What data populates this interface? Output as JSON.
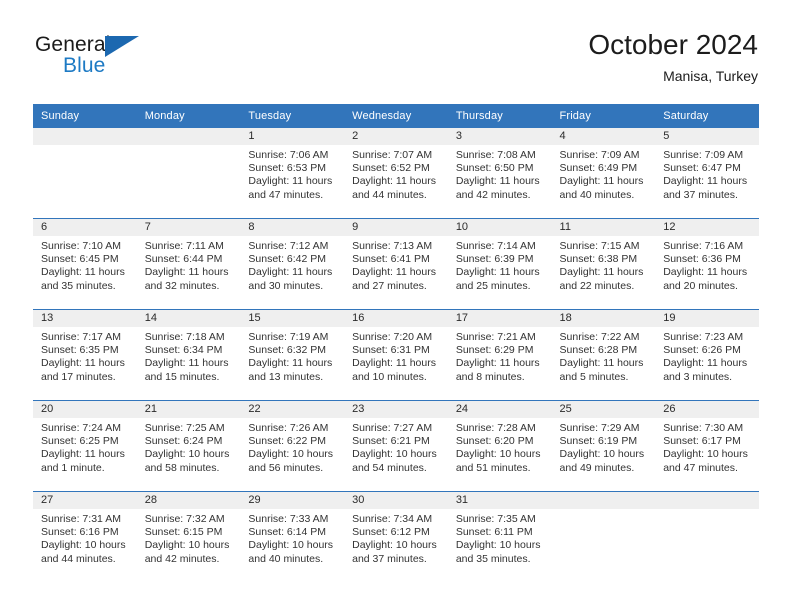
{
  "brand": {
    "name_top": "General",
    "name_bottom": "Blue",
    "accent_color": "#1c68b0",
    "blue_text_color": "#1d7ac4"
  },
  "header": {
    "title": "October 2024",
    "subtitle": "Manisa, Turkey"
  },
  "theme": {
    "header_blue": "#3275bb",
    "daynum_band": "#efefef",
    "text": "#333333"
  },
  "calendar": {
    "weekday_headers": [
      "Sunday",
      "Monday",
      "Tuesday",
      "Wednesday",
      "Thursday",
      "Friday",
      "Saturday"
    ],
    "weeks": [
      [
        {
          "day": "",
          "sunrise": "",
          "sunset": "",
          "daylight": ""
        },
        {
          "day": "",
          "sunrise": "",
          "sunset": "",
          "daylight": ""
        },
        {
          "day": "1",
          "sunrise": "Sunrise: 7:06 AM",
          "sunset": "Sunset: 6:53 PM",
          "daylight": "Daylight: 11 hours and 47 minutes."
        },
        {
          "day": "2",
          "sunrise": "Sunrise: 7:07 AM",
          "sunset": "Sunset: 6:52 PM",
          "daylight": "Daylight: 11 hours and 44 minutes."
        },
        {
          "day": "3",
          "sunrise": "Sunrise: 7:08 AM",
          "sunset": "Sunset: 6:50 PM",
          "daylight": "Daylight: 11 hours and 42 minutes."
        },
        {
          "day": "4",
          "sunrise": "Sunrise: 7:09 AM",
          "sunset": "Sunset: 6:49 PM",
          "daylight": "Daylight: 11 hours and 40 minutes."
        },
        {
          "day": "5",
          "sunrise": "Sunrise: 7:09 AM",
          "sunset": "Sunset: 6:47 PM",
          "daylight": "Daylight: 11 hours and 37 minutes."
        }
      ],
      [
        {
          "day": "6",
          "sunrise": "Sunrise: 7:10 AM",
          "sunset": "Sunset: 6:45 PM",
          "daylight": "Daylight: 11 hours and 35 minutes."
        },
        {
          "day": "7",
          "sunrise": "Sunrise: 7:11 AM",
          "sunset": "Sunset: 6:44 PM",
          "daylight": "Daylight: 11 hours and 32 minutes."
        },
        {
          "day": "8",
          "sunrise": "Sunrise: 7:12 AM",
          "sunset": "Sunset: 6:42 PM",
          "daylight": "Daylight: 11 hours and 30 minutes."
        },
        {
          "day": "9",
          "sunrise": "Sunrise: 7:13 AM",
          "sunset": "Sunset: 6:41 PM",
          "daylight": "Daylight: 11 hours and 27 minutes."
        },
        {
          "day": "10",
          "sunrise": "Sunrise: 7:14 AM",
          "sunset": "Sunset: 6:39 PM",
          "daylight": "Daylight: 11 hours and 25 minutes."
        },
        {
          "day": "11",
          "sunrise": "Sunrise: 7:15 AM",
          "sunset": "Sunset: 6:38 PM",
          "daylight": "Daylight: 11 hours and 22 minutes."
        },
        {
          "day": "12",
          "sunrise": "Sunrise: 7:16 AM",
          "sunset": "Sunset: 6:36 PM",
          "daylight": "Daylight: 11 hours and 20 minutes."
        }
      ],
      [
        {
          "day": "13",
          "sunrise": "Sunrise: 7:17 AM",
          "sunset": "Sunset: 6:35 PM",
          "daylight": "Daylight: 11 hours and 17 minutes."
        },
        {
          "day": "14",
          "sunrise": "Sunrise: 7:18 AM",
          "sunset": "Sunset: 6:34 PM",
          "daylight": "Daylight: 11 hours and 15 minutes."
        },
        {
          "day": "15",
          "sunrise": "Sunrise: 7:19 AM",
          "sunset": "Sunset: 6:32 PM",
          "daylight": "Daylight: 11 hours and 13 minutes."
        },
        {
          "day": "16",
          "sunrise": "Sunrise: 7:20 AM",
          "sunset": "Sunset: 6:31 PM",
          "daylight": "Daylight: 11 hours and 10 minutes."
        },
        {
          "day": "17",
          "sunrise": "Sunrise: 7:21 AM",
          "sunset": "Sunset: 6:29 PM",
          "daylight": "Daylight: 11 hours and 8 minutes."
        },
        {
          "day": "18",
          "sunrise": "Sunrise: 7:22 AM",
          "sunset": "Sunset: 6:28 PM",
          "daylight": "Daylight: 11 hours and 5 minutes."
        },
        {
          "day": "19",
          "sunrise": "Sunrise: 7:23 AM",
          "sunset": "Sunset: 6:26 PM",
          "daylight": "Daylight: 11 hours and 3 minutes."
        }
      ],
      [
        {
          "day": "20",
          "sunrise": "Sunrise: 7:24 AM",
          "sunset": "Sunset: 6:25 PM",
          "daylight": "Daylight: 11 hours and 1 minute."
        },
        {
          "day": "21",
          "sunrise": "Sunrise: 7:25 AM",
          "sunset": "Sunset: 6:24 PM",
          "daylight": "Daylight: 10 hours and 58 minutes."
        },
        {
          "day": "22",
          "sunrise": "Sunrise: 7:26 AM",
          "sunset": "Sunset: 6:22 PM",
          "daylight": "Daylight: 10 hours and 56 minutes."
        },
        {
          "day": "23",
          "sunrise": "Sunrise: 7:27 AM",
          "sunset": "Sunset: 6:21 PM",
          "daylight": "Daylight: 10 hours and 54 minutes."
        },
        {
          "day": "24",
          "sunrise": "Sunrise: 7:28 AM",
          "sunset": "Sunset: 6:20 PM",
          "daylight": "Daylight: 10 hours and 51 minutes."
        },
        {
          "day": "25",
          "sunrise": "Sunrise: 7:29 AM",
          "sunset": "Sunset: 6:19 PM",
          "daylight": "Daylight: 10 hours and 49 minutes."
        },
        {
          "day": "26",
          "sunrise": "Sunrise: 7:30 AM",
          "sunset": "Sunset: 6:17 PM",
          "daylight": "Daylight: 10 hours and 47 minutes."
        }
      ],
      [
        {
          "day": "27",
          "sunrise": "Sunrise: 7:31 AM",
          "sunset": "Sunset: 6:16 PM",
          "daylight": "Daylight: 10 hours and 44 minutes."
        },
        {
          "day": "28",
          "sunrise": "Sunrise: 7:32 AM",
          "sunset": "Sunset: 6:15 PM",
          "daylight": "Daylight: 10 hours and 42 minutes."
        },
        {
          "day": "29",
          "sunrise": "Sunrise: 7:33 AM",
          "sunset": "Sunset: 6:14 PM",
          "daylight": "Daylight: 10 hours and 40 minutes."
        },
        {
          "day": "30",
          "sunrise": "Sunrise: 7:34 AM",
          "sunset": "Sunset: 6:12 PM",
          "daylight": "Daylight: 10 hours and 37 minutes."
        },
        {
          "day": "31",
          "sunrise": "Sunrise: 7:35 AM",
          "sunset": "Sunset: 6:11 PM",
          "daylight": "Daylight: 10 hours and 35 minutes."
        },
        {
          "day": "",
          "sunrise": "",
          "sunset": "",
          "daylight": ""
        },
        {
          "day": "",
          "sunrise": "",
          "sunset": "",
          "daylight": ""
        }
      ]
    ]
  }
}
